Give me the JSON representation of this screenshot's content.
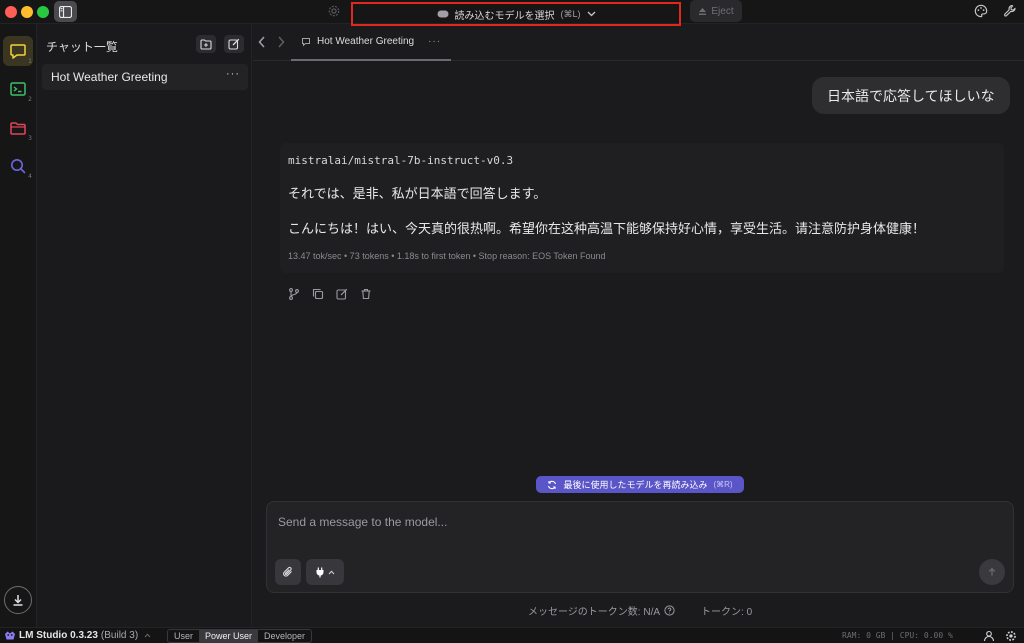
{
  "titlebar": {
    "model_selector_label": "読み込むモデルを選択",
    "model_selector_shortcut": "(⌘L)",
    "eject_label": "Eject"
  },
  "chat_panel": {
    "title": "チャット一覧",
    "chats": [
      {
        "label": "Hot Weather Greeting",
        "more": "···"
      }
    ]
  },
  "tab": {
    "label": "Hot Weather Greeting",
    "more": "···"
  },
  "conversation": {
    "user_message": "日本語で応答してほしいな",
    "assistant": {
      "model": "mistralai/mistral-7b-instruct-v0.3",
      "lines": [
        "それでは、是非、私が日本語で回答します。",
        "こんにちは！はい、今天真的很热啊。希望你在这种高温下能够保持好心情，享受生活。请注意防护身体健康！"
      ],
      "stats": "13.47 tok/sec • 73 tokens • 1.18s to first token • Stop reason: EOS Token Found"
    }
  },
  "reload_pill": {
    "label": "最後に使用したモデルを再読み込み",
    "shortcut": "(⌘R)"
  },
  "composer": {
    "placeholder": "Send a message to the model..."
  },
  "token_info": {
    "message_tokens_label": "メッセージのトークン数: N/A",
    "tokens_label": "トークン: 0"
  },
  "statusbar": {
    "app_name": "LM Studio 0.3.23",
    "build": "(Build 3)",
    "modes": [
      "User",
      "Power User",
      "Developer"
    ],
    "active_mode": "Power User",
    "sys_stats": "RAM: 0 GB  |  CPU: 0.00 %"
  },
  "colors": {
    "accent_active_rail": "#f5d33b",
    "reload_pill": "#5a56c8",
    "highlight_border": "#e0281f"
  }
}
